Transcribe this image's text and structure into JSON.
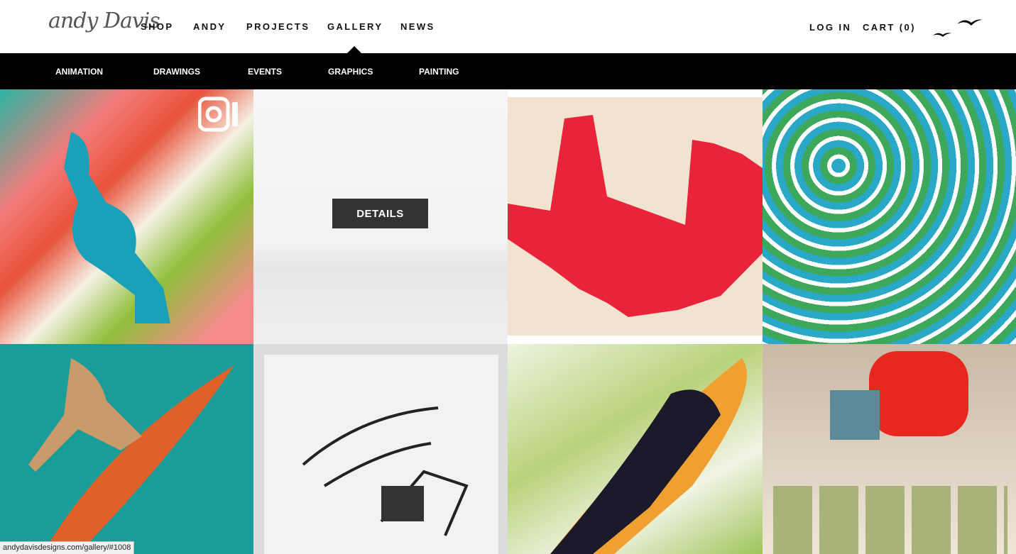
{
  "header": {
    "logo": "andy Davis",
    "nav": [
      "SHOP",
      "ANDY",
      "PROJECTS",
      "GALLERY",
      "NEWS"
    ],
    "active_nav": "GALLERY",
    "log_in": "LOG IN",
    "cart": "CART (0)"
  },
  "subnav": [
    "ANIMATION",
    "DRAWINGS",
    "EVENTS",
    "GRAPHICS",
    "PAINTING"
  ],
  "gallery": {
    "details_label": "DETAILS"
  },
  "status_url": "andydavisdesigns.com/gallery/#1008"
}
